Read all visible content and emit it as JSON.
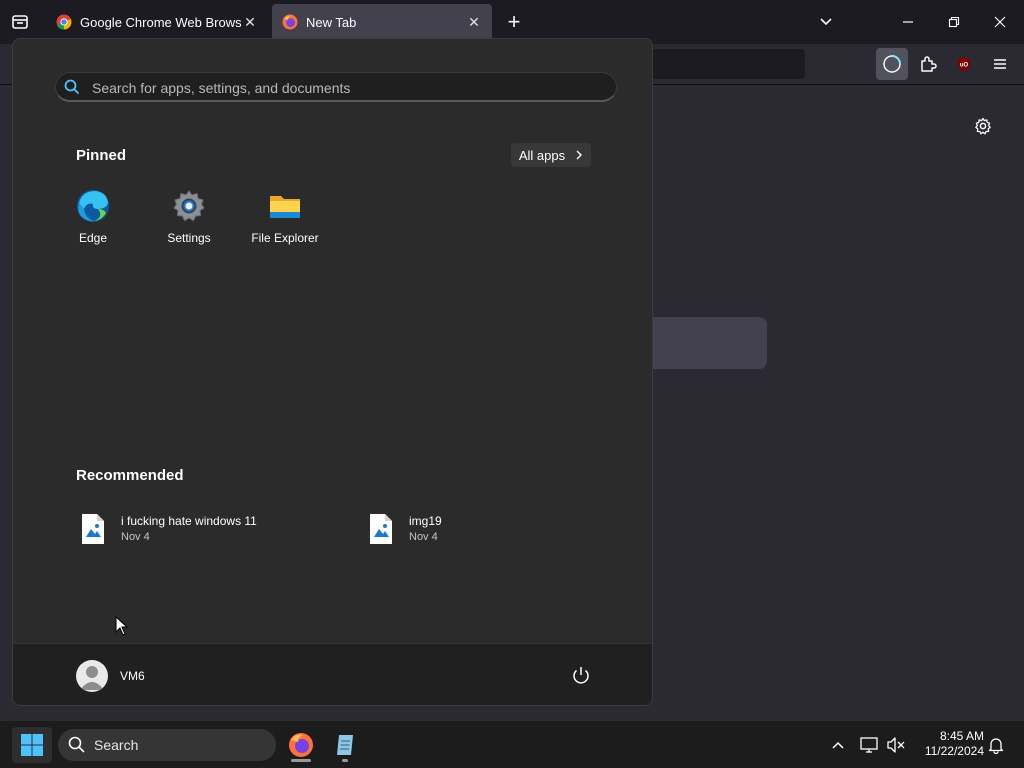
{
  "browser": {
    "tabs": [
      {
        "title": "Google Chrome Web Browser",
        "active": false
      },
      {
        "title": "New Tab",
        "active": true
      }
    ],
    "close_glyph": "✕",
    "new_tab_glyph": "+"
  },
  "start_menu": {
    "search": {
      "placeholder": "Search for apps, settings, and documents"
    },
    "pinned": {
      "title": "Pinned",
      "all_apps_label": "All apps",
      "apps": [
        {
          "label": "Edge",
          "icon": "edge-icon"
        },
        {
          "label": "Settings",
          "icon": "settings-gear-icon"
        },
        {
          "label": "File Explorer",
          "icon": "folder-icon"
        }
      ]
    },
    "recommended": {
      "title": "Recommended",
      "items": [
        {
          "name": "i fucking hate windows 11",
          "date": "Nov 4",
          "icon": "image-file-icon"
        },
        {
          "name": "img19",
          "date": "Nov 4",
          "icon": "image-file-icon"
        }
      ]
    },
    "user": {
      "name": "VM6"
    }
  },
  "taskbar": {
    "search_label": "Search",
    "clock": {
      "time": "8:45 AM",
      "date": "11/22/2024"
    }
  },
  "colors": {
    "accent": "#0078d4",
    "firefox_orange": "#ff7139",
    "start_bg": "#2b2b2b",
    "taskbar_bg": "#1c1c1c"
  }
}
